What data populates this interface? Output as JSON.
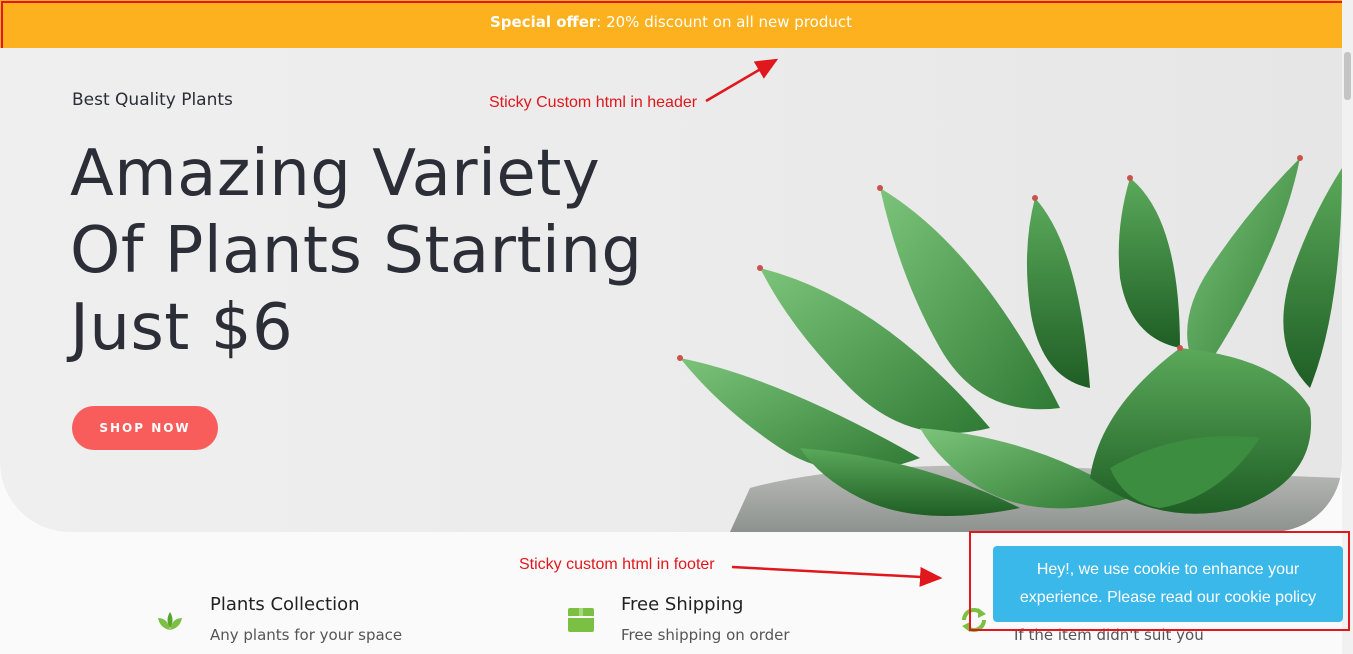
{
  "offer_bar": {
    "label": "Special offer",
    "text": ": 20% discount on all new product",
    "background": "#fdb11e"
  },
  "hero": {
    "eyebrow": "Best Quality Plants",
    "title_lines": [
      "Amazing Variety",
      "Of Plants Starting",
      "Just $6"
    ],
    "button_label": "SHOP NOW",
    "button_color": "#f85d5b"
  },
  "annotations": {
    "header": "Sticky Custom html in header",
    "footer": "Sticky custom html in footer",
    "color": "#e0171c"
  },
  "features": [
    {
      "icon": "leaf-icon",
      "title": "Plants Collection",
      "desc": "Any plants for your space"
    },
    {
      "icon": "box-icon",
      "title": "Free Shipping",
      "desc": "Free shipping on order"
    },
    {
      "icon": "refresh-icon",
      "title": "",
      "desc": "If the item didn't suit you"
    }
  ],
  "cookie": {
    "text_line1": "Hey!, we use cookie to enhance your",
    "text_line2": "experience. Please read our cookie policy",
    "background": "#3ab8ea"
  }
}
